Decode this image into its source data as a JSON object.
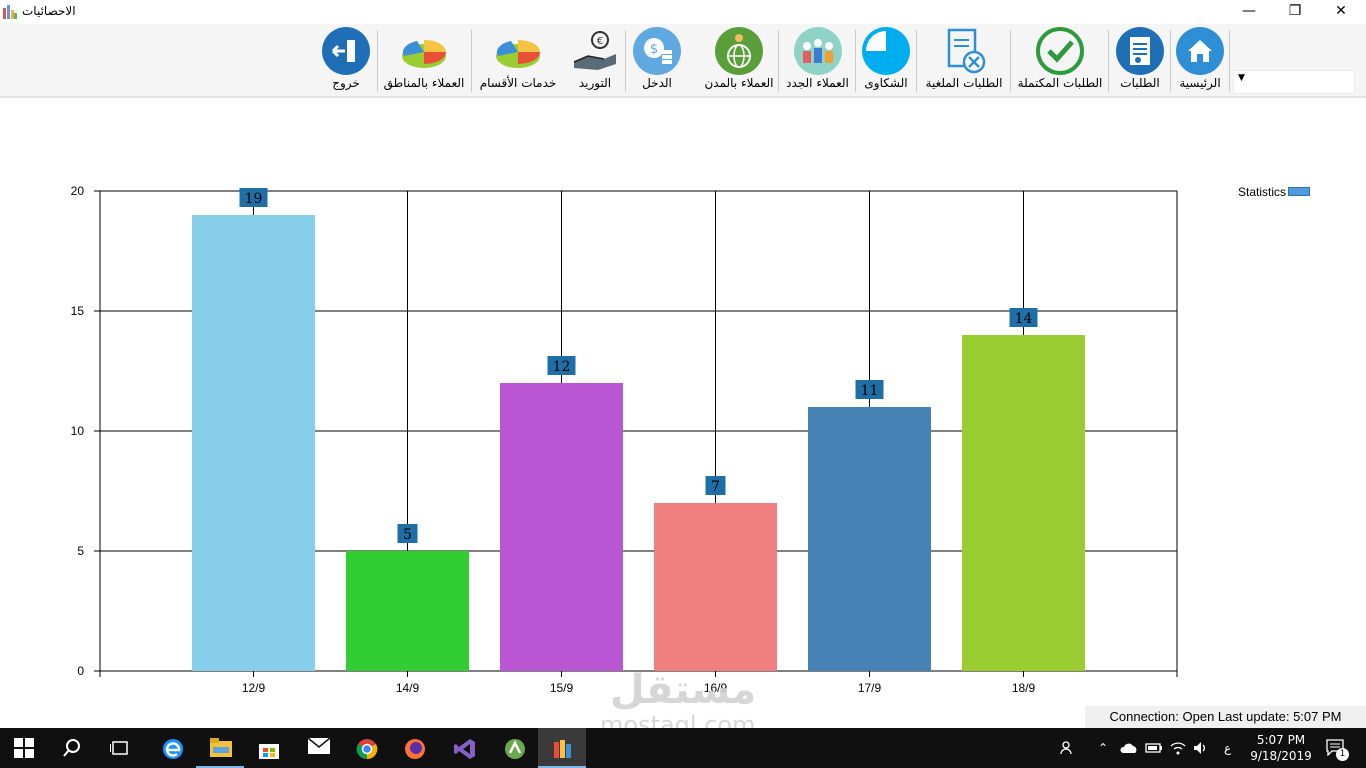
{
  "window": {
    "title": "الاحصائيات",
    "minimize": "—",
    "restore": "❐",
    "close": "✕"
  },
  "toolbar": {
    "combo_value": "",
    "items": [
      {
        "label": "الرئيسية",
        "icon": "home-icon"
      },
      {
        "label": "الطلبات",
        "icon": "orders-icon"
      },
      {
        "label": "الطلبات المكتملة",
        "icon": "check-icon"
      },
      {
        "label": "الطلبات الملغية",
        "icon": "cancel-document-icon"
      },
      {
        "label": "الشكاوى",
        "icon": "pie-quarter-icon"
      },
      {
        "label": "العملاء الجدد",
        "icon": "people-icon"
      },
      {
        "label": "العملاء بالمدن",
        "icon": "globe-people-icon"
      },
      {
        "label": "الدخل",
        "icon": "coins-icon"
      },
      {
        "label": "التوريد",
        "icon": "hand-money-icon"
      },
      {
        "label": "خدمات الأقسام",
        "icon": "pie-chart-icon"
      },
      {
        "label": "العملاء بالمناطق",
        "icon": "pie-chart-3d-icon"
      },
      {
        "label": "خروج",
        "icon": "exit-icon"
      }
    ]
  },
  "chart_data": {
    "type": "bar",
    "categories": [
      "12/9",
      "14/9",
      "15/9",
      "16/9",
      "17/9",
      "18/9"
    ],
    "values": [
      19,
      5,
      12,
      7,
      11,
      14
    ],
    "colors": [
      "#87ceeb",
      "#32cd32",
      "#ba55d3",
      "#f08080",
      "#4682b4",
      "#9acd32"
    ],
    "legend": "Statistics",
    "legend_position": "top-right",
    "ylim": [
      0,
      20
    ],
    "yticks": [
      0,
      5,
      10,
      15,
      20
    ],
    "grid": true,
    "label_color": "#1f6fa6"
  },
  "status": {
    "text": "Connection: Open Last update: 5:07 PM"
  },
  "taskbar": {
    "time": "5:07 PM",
    "date": "9/18/2019",
    "lang": "ع",
    "notifications": "1",
    "apps": [
      "start-icon",
      "search-icon",
      "task-view-icon",
      "edge-icon",
      "file-explorer-icon",
      "store-icon",
      "mail-icon",
      "chrome-icon",
      "firefox-icon",
      "visual-studio-icon",
      "android-studio-icon",
      "books-app-icon"
    ]
  },
  "watermark": {
    "arabic": "مستقل",
    "latin": "mostaql.com"
  }
}
